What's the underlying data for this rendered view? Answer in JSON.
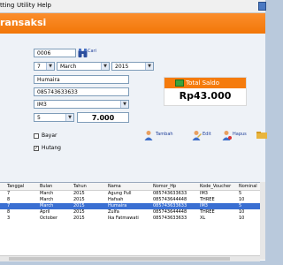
{
  "menu": [
    "tting",
    "Utility",
    "Help"
  ],
  "header": {
    "title": "ransaksi"
  },
  "form": {
    "kode": "0006",
    "cari_label": "Cari",
    "day": "7",
    "month": "March",
    "year": "2015",
    "nama": "Humaira",
    "nomor_hp": "085743633633",
    "voucher": "IM3",
    "nominal": "5",
    "amount": "7.000"
  },
  "saldo": {
    "title": "Total Saldo",
    "value": "Rp43.000"
  },
  "checkboxes": [
    {
      "label": "Bayar",
      "checked": false
    },
    {
      "label": "Hutang",
      "checked": true
    }
  ],
  "actions": {
    "tambah": "Tambah",
    "edit": "Edit",
    "hapus": "Hapus"
  },
  "table": {
    "columns": [
      "Tanggal",
      "Bulan",
      "Tahun",
      "Nama",
      "Nomor_Hp",
      "Kode_Voucher",
      "Nominal"
    ],
    "rows": [
      [
        "7",
        "March",
        "2015",
        "Agung Pull",
        "085743633633",
        "IM3",
        "5"
      ],
      [
        "8",
        "March",
        "2015",
        "Hafsah",
        "085743644448",
        "THREE",
        "10"
      ],
      [
        "7",
        "March",
        "2015",
        "Humaira",
        "085743633633",
        "IM3",
        "5"
      ],
      [
        "8",
        "April",
        "2015",
        "Zulfa",
        "085743644448",
        "THREE",
        "10"
      ],
      [
        "3",
        "October",
        "2015",
        "Ika Fatmawati",
        "085743633633",
        "XL",
        "10"
      ]
    ],
    "selected_row": 2
  },
  "colors": {
    "accent": "#f27708",
    "selection": "#3a6fd2",
    "money_green": "#3ba33b"
  }
}
